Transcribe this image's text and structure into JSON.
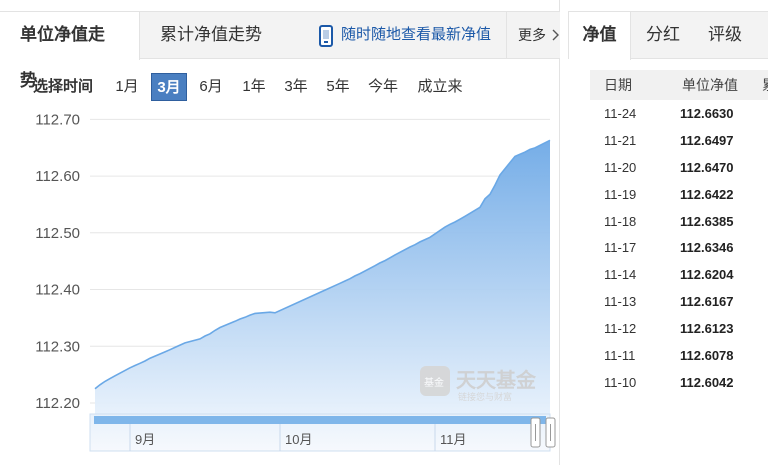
{
  "left_tabs": {
    "unit_nav": "单位净值走势",
    "cum_nav": "累计净值走势"
  },
  "promo": {
    "text": "随时随地查看最新净值",
    "icon": "phone-icon"
  },
  "more": {
    "label": "更多",
    "icon": "chevron-right-icon"
  },
  "range_selector": {
    "label": "选择时间",
    "options": [
      "1月",
      "3月",
      "6月",
      "1年",
      "3年",
      "5年",
      "今年",
      "成立来"
    ],
    "selected": "3月"
  },
  "colors": {
    "accent": "#4a7fc1",
    "area": "#78b3e8",
    "line": "#6aa8e6"
  },
  "watermark": {
    "title": "天天基金",
    "sub": "链接您与财富",
    "badge": "基金"
  },
  "chart_data": {
    "type": "area",
    "title": "",
    "xlabel": "",
    "ylabel": "",
    "ylim": [
      112.17,
      112.72
    ],
    "yticks": [
      "112.70",
      "112.60",
      "112.50",
      "112.40",
      "112.30",
      "112.20"
    ],
    "xticks": [
      "9月",
      "10月",
      "11月"
    ],
    "grid": true,
    "x_span": [
      "2025-08-24",
      "2025-11-24"
    ],
    "xtick_dates": [
      "2025-09-01",
      "2025-10-01",
      "2025-11-01"
    ],
    "series": [
      {
        "x": [
          "2025-08-25",
          "2025-08-26",
          "2025-08-27",
          "2025-08-28",
          "2025-08-29",
          "2025-09-01",
          "2025-09-02",
          "2025-09-03",
          "2025-09-04",
          "2025-09-05",
          "2025-09-08",
          "2025-09-09",
          "2025-09-10",
          "2025-09-11",
          "2025-09-12",
          "2025-09-15",
          "2025-09-16",
          "2025-09-17",
          "2025-09-18",
          "2025-09-19",
          "2025-09-22",
          "2025-09-23",
          "2025-09-24",
          "2025-09-25",
          "2025-09-26",
          "2025-09-29",
          "2025-09-30",
          "2025-10-09",
          "2025-10-10",
          "2025-10-13",
          "2025-10-14",
          "2025-10-15",
          "2025-10-16",
          "2025-10-17",
          "2025-10-20",
          "2025-10-21",
          "2025-10-22",
          "2025-10-23",
          "2025-10-24",
          "2025-10-27",
          "2025-10-28",
          "2025-10-29",
          "2025-10-30",
          "2025-10-31",
          "2025-11-03",
          "2025-11-04",
          "2025-11-05",
          "2025-11-06",
          "2025-11-07",
          "2025-11-10",
          "2025-11-11",
          "2025-11-12",
          "2025-11-13",
          "2025-11-14",
          "2025-11-17",
          "2025-11-18",
          "2025-11-19",
          "2025-11-20",
          "2025-11-21",
          "2025-11-24"
        ],
        "values": [
          112.225,
          112.232,
          112.238,
          112.243,
          112.248,
          112.262,
          112.266,
          112.27,
          112.274,
          112.279,
          112.29,
          112.294,
          112.298,
          112.302,
          112.306,
          112.313,
          112.318,
          112.322,
          112.328,
          112.333,
          112.344,
          112.348,
          112.351,
          112.355,
          112.358,
          112.36,
          112.359,
          112.395,
          112.399,
          112.411,
          112.415,
          112.419,
          112.424,
          112.428,
          112.442,
          112.447,
          112.451,
          112.456,
          112.461,
          112.475,
          112.479,
          112.484,
          112.488,
          112.492,
          112.51,
          112.515,
          112.519,
          112.524,
          112.529,
          112.545,
          112.56,
          112.568,
          112.584,
          112.602,
          112.6346,
          112.6385,
          112.6422,
          112.647,
          112.6497,
          112.663
        ]
      }
    ]
  },
  "nav_table": {
    "headers": {
      "date": "日期",
      "value": "单位净值",
      "extra": "累"
    },
    "rows": [
      {
        "date": "11-24",
        "value": "112.6630"
      },
      {
        "date": "11-21",
        "value": "112.6497"
      },
      {
        "date": "11-20",
        "value": "112.6470"
      },
      {
        "date": "11-19",
        "value": "112.6422"
      },
      {
        "date": "11-18",
        "value": "112.6385"
      },
      {
        "date": "11-17",
        "value": "112.6346"
      },
      {
        "date": "11-14",
        "value": "112.6204"
      },
      {
        "date": "11-13",
        "value": "112.6167"
      },
      {
        "date": "11-12",
        "value": "112.6123"
      },
      {
        "date": "11-11",
        "value": "112.6078"
      },
      {
        "date": "11-10",
        "value": "112.6042"
      }
    ]
  },
  "right_tabs": {
    "nav": "净值",
    "dividend": "分红",
    "rating": "评级"
  }
}
